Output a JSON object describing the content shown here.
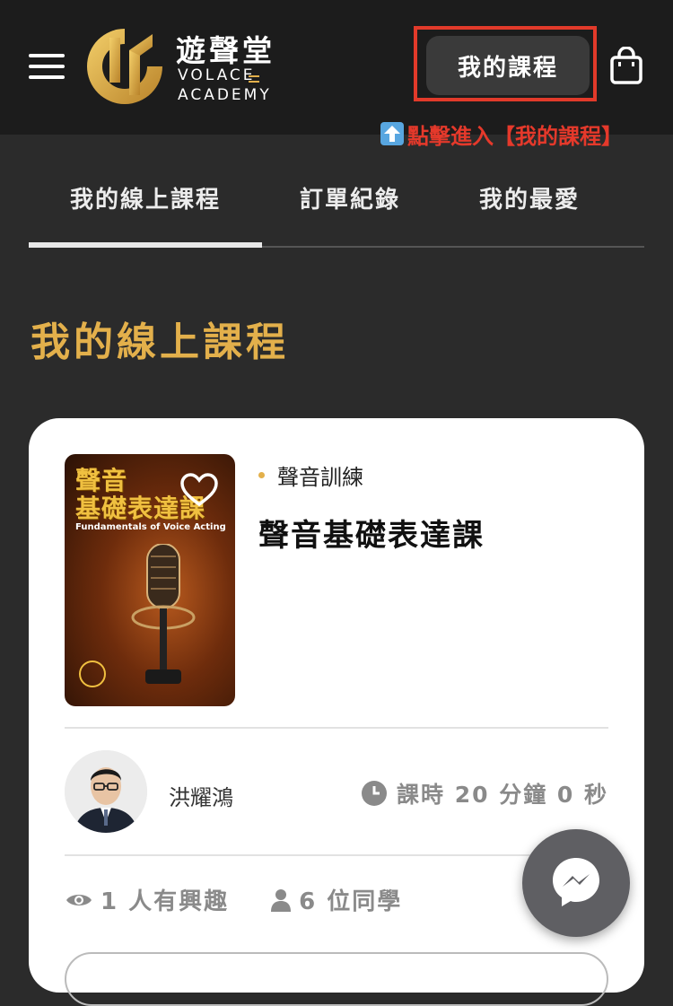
{
  "header": {
    "logo_cn": "遊聲堂",
    "logo_en_line1": "VOLACE",
    "logo_en_line2": "ACADEMY",
    "my_courses_button": "我的課程",
    "hint_text": "點擊進入【我的課程】"
  },
  "tabs": [
    {
      "label": "我的線上課程",
      "active": true
    },
    {
      "label": "訂單紀錄",
      "active": false
    },
    {
      "label": "我的最愛",
      "active": false
    }
  ],
  "section_title": "我的線上課程",
  "course": {
    "cover_title_line1": "聲音",
    "cover_title_line2": "基礎表達課",
    "cover_subtitle": "Fundamentals of Voice Acting",
    "category": "聲音訓練",
    "title": "聲音基礎表達課",
    "teacher": "洪耀鴻",
    "duration": "課時 20 分鐘 0 秒",
    "interested": "1 人有興趣",
    "students": "6 位同學"
  },
  "colors": {
    "accent_gold": "#e3b04b",
    "hint_red": "#e5392b",
    "header_bg": "#1c1c1c",
    "page_bg": "#2b2b2b"
  },
  "icons": [
    "hamburger-menu-icon",
    "shopping-bag-icon",
    "up-arrow-icon",
    "heart-icon",
    "clock-icon",
    "eye-icon",
    "person-icon",
    "messenger-icon"
  ]
}
